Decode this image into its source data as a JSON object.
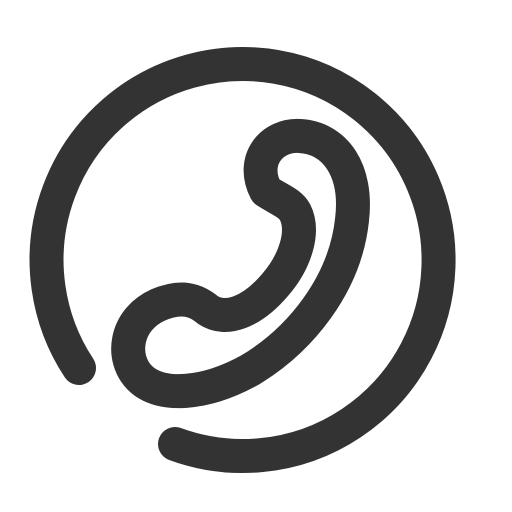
{
  "icon": {
    "name": "phone-in-circle-icon",
    "stroke_color": "#333333",
    "background_color": "#ffffff"
  }
}
